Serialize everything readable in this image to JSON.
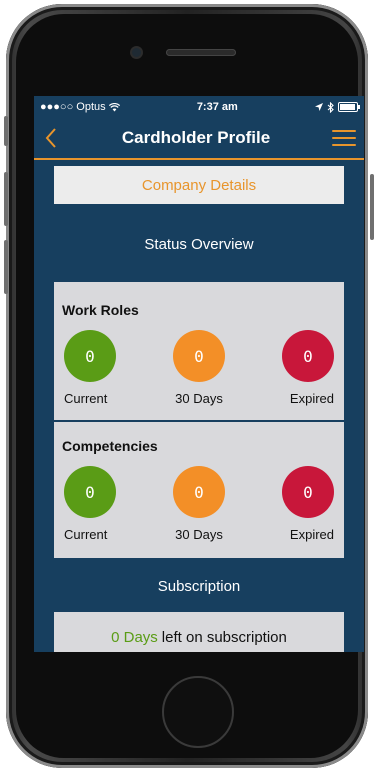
{
  "status_bar": {
    "carrier": "●●●○○ Optus",
    "time": "7:37 am",
    "icons": [
      "wifi-icon",
      "location-arrow-icon",
      "bluetooth-icon",
      "battery-icon"
    ]
  },
  "nav": {
    "title": "Cardholder Profile",
    "back_icon": "chevron-left-icon",
    "menu_icon": "hamburger-menu-icon"
  },
  "company": {
    "label": "Company Details"
  },
  "status_overview": {
    "title": "Status Overview",
    "work_roles": {
      "heading": "Work Roles",
      "current": {
        "count": "0",
        "label": "Current"
      },
      "days30": {
        "count": "0",
        "label": "30 Days"
      },
      "expired": {
        "count": "0",
        "label": "Expired"
      }
    },
    "competencies": {
      "heading": "Competencies",
      "current": {
        "count": "0",
        "label": "Current"
      },
      "days30": {
        "count": "0",
        "label": "30 Days"
      },
      "expired": {
        "count": "0",
        "label": "Expired"
      }
    }
  },
  "subscription": {
    "title": "Subscription",
    "days": "0 Days",
    "suffix": "left on subscription"
  },
  "colors": {
    "background": "#173f5f",
    "accent": "#e8952c",
    "current": "#5a9c16",
    "days30": "#f38f27",
    "expired": "#c8173a"
  }
}
